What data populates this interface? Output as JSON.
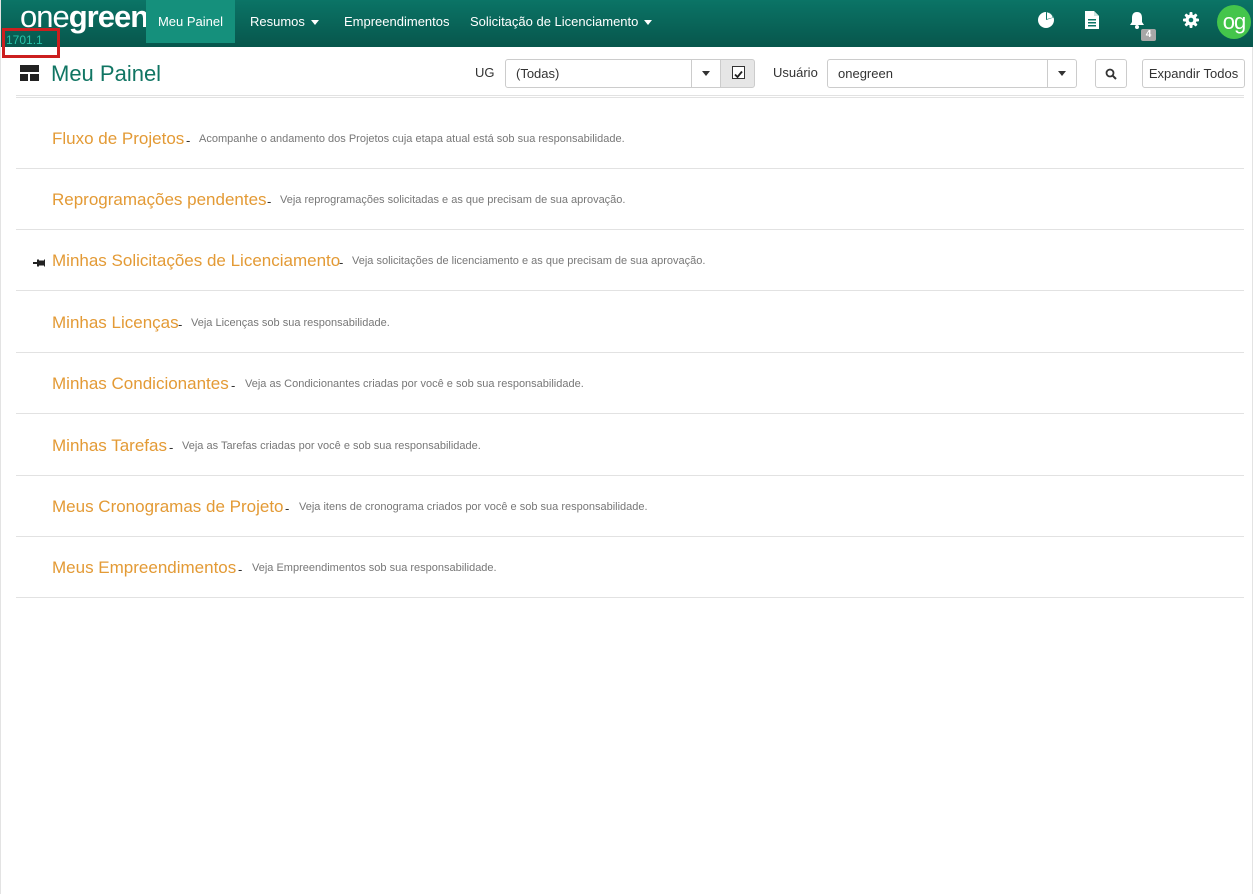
{
  "app": {
    "logo_part1": "one",
    "logo_part2": "green",
    "version": "1701.1",
    "avatar_text": "og",
    "notification_count": "4"
  },
  "nav": {
    "items": [
      {
        "label": "Meu Painel",
        "active": true,
        "dropdown": false
      },
      {
        "label": "Resumos",
        "active": false,
        "dropdown": true
      },
      {
        "label": "Empreendimentos",
        "active": false,
        "dropdown": false
      },
      {
        "label": "Solicitação de Licenciamento",
        "active": false,
        "dropdown": true
      }
    ],
    "icons": [
      "pie-chart-icon",
      "document-icon",
      "bell-icon",
      "gear-icon"
    ]
  },
  "header": {
    "title": "Meu Painel",
    "ug_label": "UG",
    "ug_value": "(Todas)",
    "ug_checked": true,
    "user_label": "Usuário",
    "user_value": "onegreen",
    "expand_label": "Expandir Todos"
  },
  "sections": [
    {
      "title": "Fluxo de Projetos",
      "separator": "-",
      "description": "Acompanhe o andamento dos Projetos cuja etapa atual está sob sua responsabilidade.",
      "pinned": false
    },
    {
      "title": "Reprogramações pendentes",
      "separator": "-",
      "description": "Veja reprogramações solicitadas e as que precisam de sua aprovação.",
      "pinned": false
    },
    {
      "title": "Minhas Solicitações de Licenciamento",
      "separator": "-",
      "description": "Veja solicitações de licenciamento e as que precisam de sua aprovação.",
      "pinned": true
    },
    {
      "title": "Minhas Licenças",
      "separator": "-",
      "description": "Veja Licenças sob sua responsabilidade.",
      "pinned": false
    },
    {
      "title": "Minhas Condicionantes",
      "separator": "-",
      "description": "Veja as Condicionantes criadas por você e sob sua responsabilidade.",
      "pinned": false
    },
    {
      "title": "Minhas Tarefas",
      "separator": "-",
      "description": "Veja as Tarefas criadas por você e sob sua responsabilidade.",
      "pinned": false
    },
    {
      "title": "Meus Cronogramas de Projeto",
      "separator": "-",
      "description": "Veja itens de cronograma criados por você e sob sua responsabilidade.",
      "pinned": false
    },
    {
      "title": "Meus Empreendimentos",
      "separator": "-",
      "description": "Veja Empreendimentos sob sua responsabilidade.",
      "pinned": false
    }
  ],
  "colors": {
    "nav_bg": "#0b7466",
    "nav_active": "#15907c",
    "title": "#107563",
    "section_title": "#e39a35",
    "avatar": "#44c54b",
    "highlight_box": "#cc1f1f"
  }
}
